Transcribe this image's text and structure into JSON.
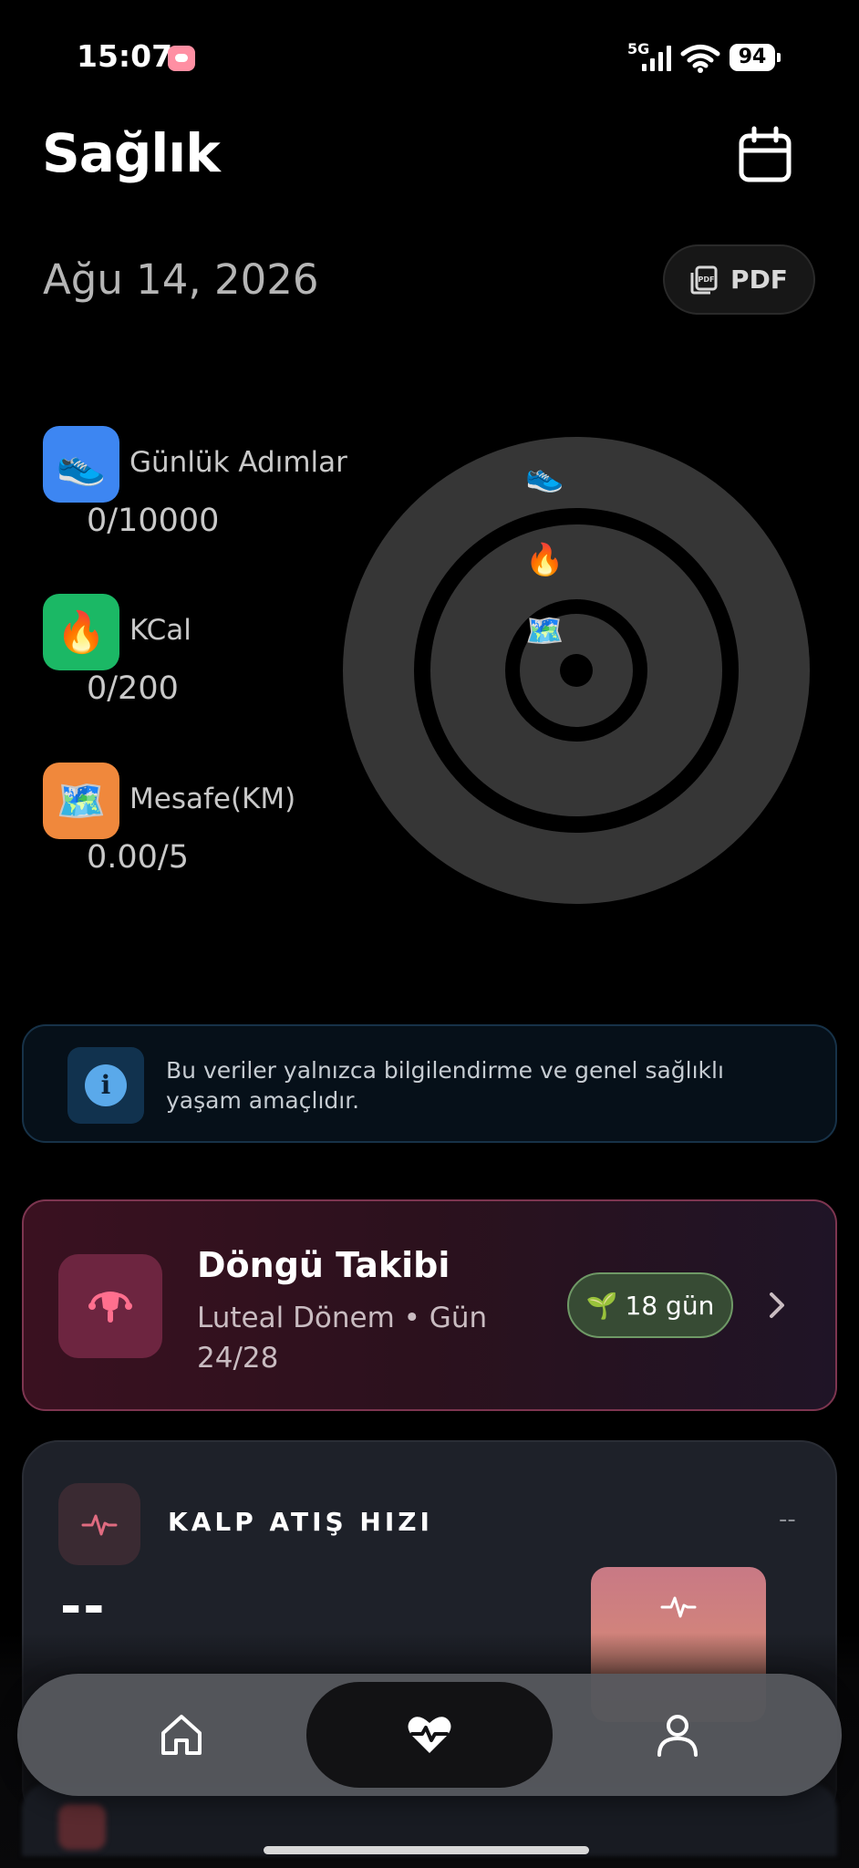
{
  "status_bar": {
    "time": "15:07",
    "network": "5G",
    "battery": "94"
  },
  "header": {
    "title": "Sağlık",
    "calendar_icon": "calendar-icon"
  },
  "date": "Ağu 14, 2026",
  "pdf_button": {
    "label": "PDF",
    "icon": "pdf-file-icon"
  },
  "metrics": [
    {
      "label": "Günlük Adımlar",
      "value": "0/10000",
      "emoji": "👟",
      "color": "#3d86f2",
      "progress": 0
    },
    {
      "label": "KCal",
      "value": "0/200",
      "emoji": "🔥",
      "color": "#1bb865",
      "progress": 0
    },
    {
      "label": "Mesafe(KM)",
      "value": "0.00/5",
      "emoji": "🗺️",
      "color": "#f0883c",
      "progress": 0
    }
  ],
  "info": {
    "text": "Bu veriler yalnızca bilgilendirme ve genel sağlıklı yaşam amaçlıdır.",
    "icon": "info-icon"
  },
  "cycle": {
    "title": "Döngü Takibi",
    "subtitle": "Luteal Dönem • Gün 24/28",
    "badge": "18 gün",
    "badge_emoji": "🌱",
    "icon": "uterus-icon"
  },
  "heart_rate": {
    "title": "KALP ATIŞ HIZI",
    "trailing": "--",
    "value": "--",
    "icon": "pulse-icon"
  },
  "bottom_nav": {
    "items": [
      "home-icon",
      "heart-pulse-icon",
      "profile-icon"
    ],
    "active": "heart-pulse-icon"
  }
}
